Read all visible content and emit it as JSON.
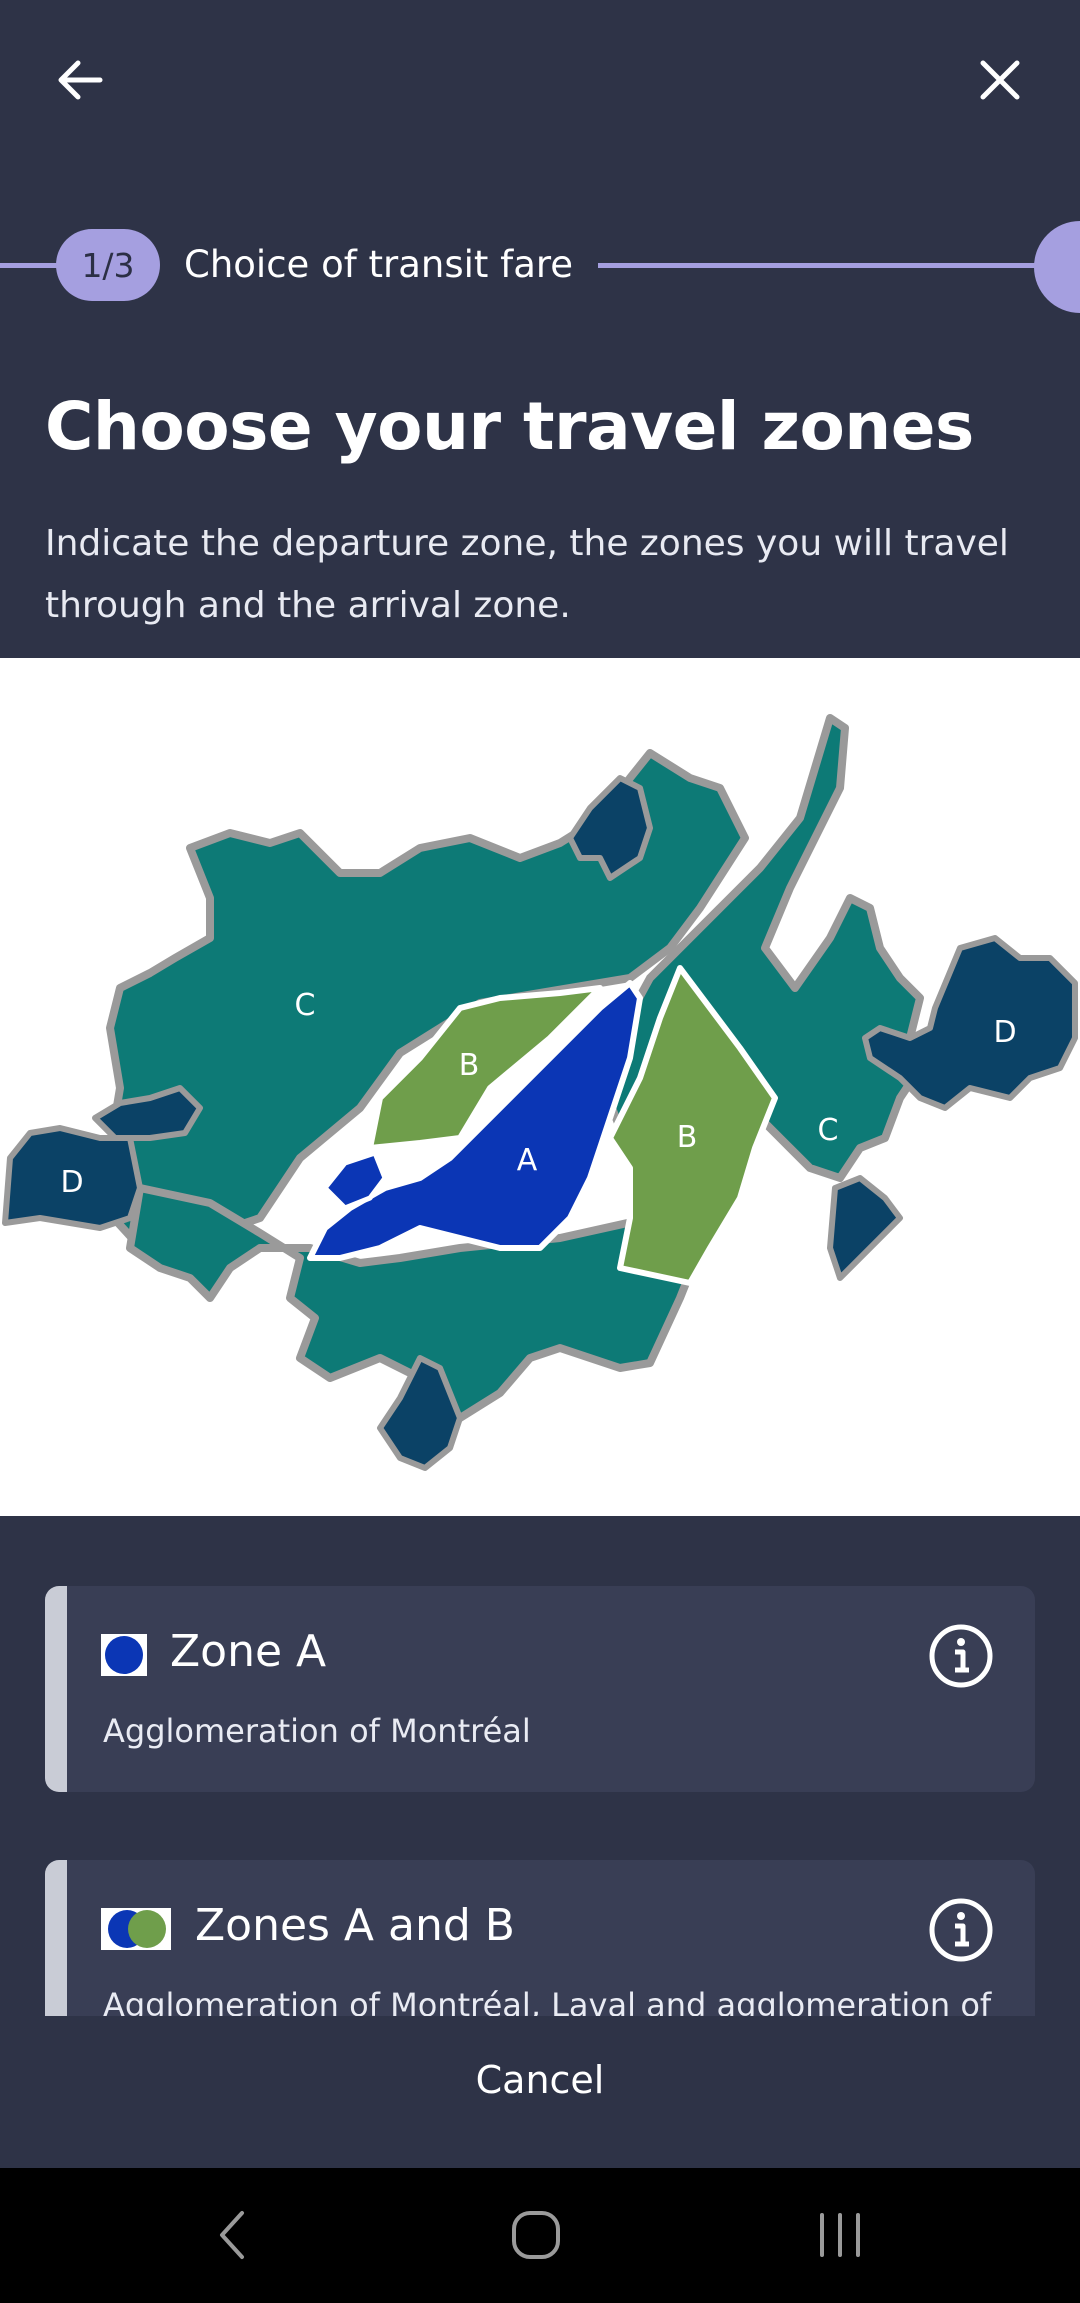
{
  "header": {
    "back_icon": "arrow-left-icon",
    "close_icon": "close-icon"
  },
  "progress": {
    "step": "1/3",
    "label": "Choice of transit fare"
  },
  "title": "Choose your travel zones",
  "subtitle": "Indicate the departure zone, the zones you will travel through and the arrival zone.",
  "map": {
    "labels": {
      "a": "A",
      "b_west": "B",
      "b_east": "B",
      "c_west": "C",
      "c_east": "C",
      "d_west": "D",
      "d_east": "D"
    },
    "colors": {
      "zone_a": "#0b36b5",
      "zone_b": "#6f9e4b",
      "zone_c": "#0d7a76",
      "zone_d": "#0b4266",
      "border": "#9a9a9a"
    }
  },
  "zones": [
    {
      "name": "Zone A",
      "description": "Agglomeration of Montréal",
      "info_icon": "info-icon"
    },
    {
      "name": "Zones A and B",
      "description": "Agglomeration of Montréal, Laval and agglomeration of",
      "info_icon": "info-icon"
    }
  ],
  "cancel_label": "Cancel",
  "system_nav": {
    "back": "back-nav-icon",
    "home": "home-nav-icon",
    "recents": "recents-nav-icon"
  }
}
